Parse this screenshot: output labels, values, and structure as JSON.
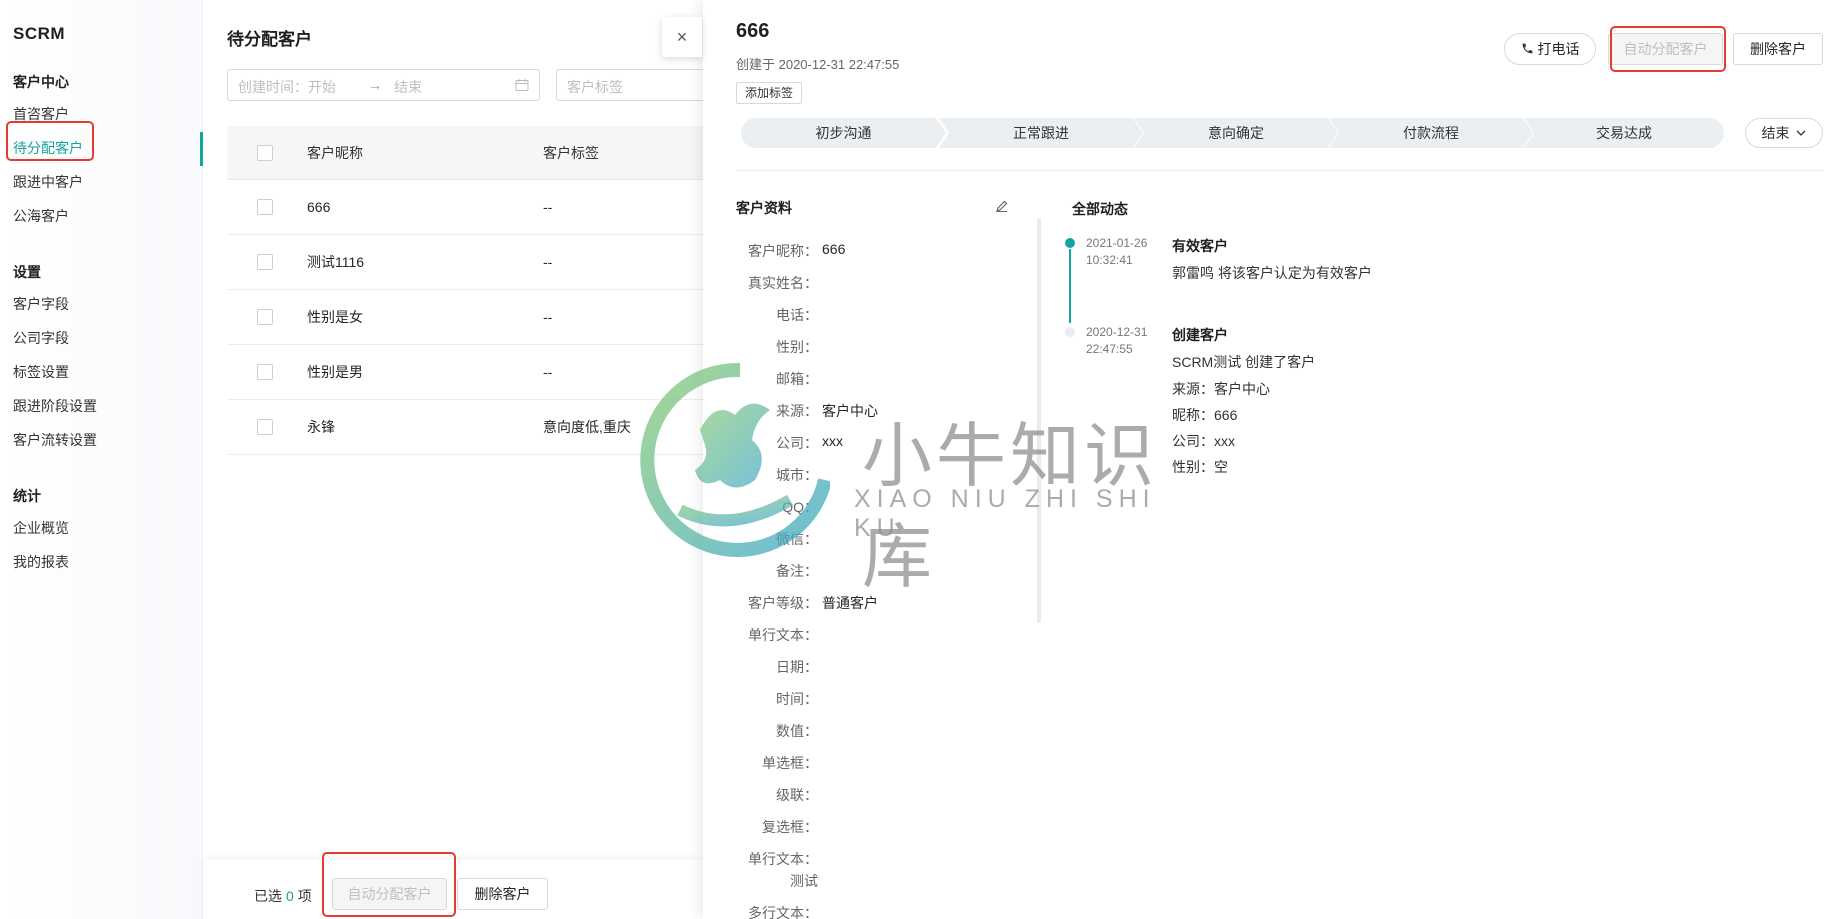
{
  "app": {
    "brand": "SCRM"
  },
  "sidebar": {
    "groups": [
      {
        "title": "客户中心",
        "items": [
          "首咨客户",
          "待分配客户",
          "跟进中客户",
          "公海客户"
        ]
      },
      {
        "title": "设置",
        "items": [
          "客户字段",
          "公司字段",
          "标签设置",
          "跟进阶段设置",
          "客户流转设置"
        ]
      },
      {
        "title": "统计",
        "items": [
          "企业概览",
          "我的报表"
        ]
      }
    ],
    "active": "待分配客户"
  },
  "list": {
    "title": "待分配客户",
    "date_prefix": "创建时间：",
    "date_start": "开始",
    "date_arrow": "→",
    "date_end": "结束",
    "tag_placeholder": "客户标签",
    "columns": [
      "客户昵称",
      "客户标签"
    ],
    "rows": [
      {
        "name": "666",
        "tags": "--"
      },
      {
        "name": "测试1116",
        "tags": "--"
      },
      {
        "name": "性别是女",
        "tags": "--"
      },
      {
        "name": "性别是男",
        "tags": "--"
      },
      {
        "name": "永锋",
        "tags": "意向度低,重庆"
      }
    ],
    "selected_prefix": "已选",
    "selected_count": "0",
    "selected_suffix": "项",
    "auto_assign": "自动分配客户",
    "delete": "删除客户"
  },
  "drawer": {
    "close": "×",
    "title": "666",
    "created": "创建于 2020-12-31 22:47:55",
    "add_tag": "添加标签",
    "call": "打电话",
    "auto_assign": "自动分配客户",
    "delete": "删除客户",
    "stages": [
      "初步沟通",
      "正常跟进",
      "意向确定",
      "付款流程",
      "交易达成"
    ],
    "end": "结束",
    "profile_title": "客户资料",
    "fields": [
      {
        "label": "客户昵称：",
        "value": "666"
      },
      {
        "label": "真实姓名：",
        "value": ""
      },
      {
        "label": "电话：",
        "value": ""
      },
      {
        "label": "性别：",
        "value": ""
      },
      {
        "label": "邮箱：",
        "value": ""
      },
      {
        "label": "来源：",
        "value": "客户中心"
      },
      {
        "label": "公司：",
        "value": "xxx"
      },
      {
        "label": "城市：",
        "value": ""
      },
      {
        "label": "QQ：",
        "value": ""
      },
      {
        "label": "微信：",
        "value": ""
      },
      {
        "label": "备注：",
        "value": ""
      },
      {
        "label": "客户等级：",
        "value": "普通客户"
      },
      {
        "label": "单行文本：",
        "value": ""
      },
      {
        "label": "日期：",
        "value": ""
      },
      {
        "label": "时间：",
        "value": ""
      },
      {
        "label": "数值：",
        "value": ""
      },
      {
        "label": "单选框：",
        "value": ""
      },
      {
        "label": "级联：",
        "value": ""
      },
      {
        "label": "复选框：",
        "value": ""
      },
      {
        "label": "单行文本：",
        "value": ""
      },
      {
        "label": "测试",
        "value": ""
      },
      {
        "label": "多行文本：",
        "value": ""
      }
    ],
    "activity_title": "全部动态",
    "activities": [
      {
        "date": "2021-01-26",
        "time": "10:32:41",
        "title": "有效客户",
        "lines": [
          "郭雷鸣 将该客户认定为有效客户"
        ]
      },
      {
        "date": "2020-12-31",
        "time": "22:47:55",
        "title": "创建客户",
        "lines": [
          "SCRM测试 创建了客户",
          "来源：客户中心",
          "昵称：666",
          "公司：xxx",
          "性别：空"
        ]
      }
    ]
  },
  "watermark": {
    "cn": "小牛知识库",
    "en": "XIAO NIU ZHI SHI KU"
  },
  "colors": {
    "accent": "#14a4a0",
    "highlight": "#e53b2f"
  }
}
